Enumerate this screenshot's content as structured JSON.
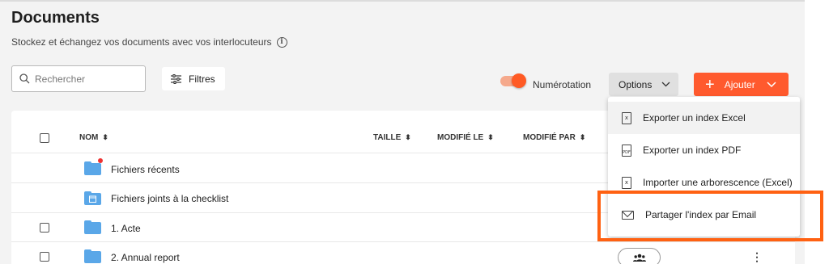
{
  "header": {
    "title": "Documents",
    "subtitle": "Stockez et échangez vos documents avec vos interlocuteurs"
  },
  "toolbar": {
    "search_placeholder": "Rechercher",
    "filters_label": "Filtres",
    "numbering_label": "Numérotation",
    "numbering_on": true,
    "options_label": "Options",
    "add_label": "Ajouter"
  },
  "table": {
    "columns": [
      "NOM",
      "TAILLE",
      "MODIFIÉ LE",
      "MODIFIÉ PAR"
    ],
    "rows": [
      {
        "name": "Fichiers récents",
        "icon": "folder-recent-icon",
        "checkbox": false
      },
      {
        "name": "Fichiers joints à la checklist",
        "icon": "folder-calendar-icon",
        "checkbox": false
      },
      {
        "name": "1. Acte",
        "icon": "folder-icon",
        "checkbox": true
      },
      {
        "name": "2. Annual report",
        "icon": "folder-icon",
        "checkbox": true
      }
    ]
  },
  "options_menu": {
    "items": [
      {
        "label": "Exporter un index Excel",
        "icon": "excel-file-icon"
      },
      {
        "label": "Exporter un index PDF",
        "icon": "pdf-file-icon"
      },
      {
        "label": "Importer une arborescence (Excel)",
        "icon": "excel-file-icon"
      },
      {
        "label": "Partager l'index par Email",
        "icon": "mail-icon"
      }
    ]
  },
  "colors": {
    "accent": "#ff5a2e",
    "highlight": "#ff6112",
    "folder": "#5aa7e8"
  }
}
